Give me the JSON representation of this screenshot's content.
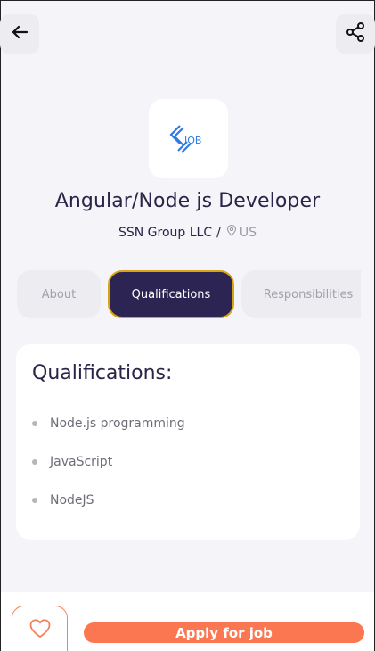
{
  "header": {
    "back_icon": "arrow-left-icon",
    "share_icon": "share-icon"
  },
  "job": {
    "logo_text": "JOB",
    "title": "Angular/Node js Developer",
    "company": "SSN Group LLC",
    "separator": "/",
    "location": "US"
  },
  "tabs": [
    {
      "label": "About",
      "active": false
    },
    {
      "label": "Qualifications",
      "active": true
    },
    {
      "label": "Responsibilities",
      "active": false
    }
  ],
  "qualifications": {
    "heading": "Qualifications:",
    "items": [
      "Node.js programming",
      "JavaScript",
      "NodeJS"
    ]
  },
  "actions": {
    "favorite_icon": "heart-icon",
    "apply_label": "Apply for job"
  },
  "colors": {
    "primary_dark": "#2c2452",
    "accent_orange": "#fb7751",
    "tab_border_active": "#d9a413",
    "logo_blue": "#2f7be5"
  }
}
